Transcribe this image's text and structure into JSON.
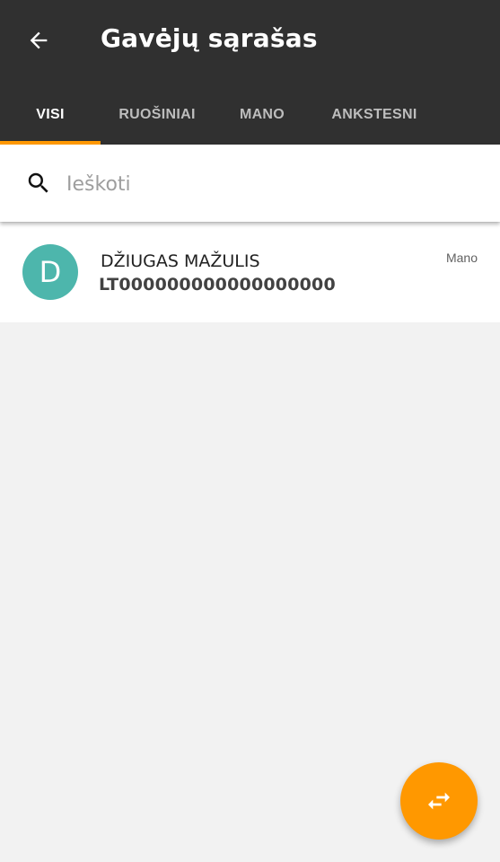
{
  "appbar": {
    "title": "Gavėjų sąrašas",
    "back_icon": "arrow-left-icon",
    "background_color": "#303030"
  },
  "tabs": [
    {
      "label": "VISI",
      "active": true
    },
    {
      "label": "RUOŠINIAI",
      "active": false
    },
    {
      "label": "MANO",
      "active": false
    },
    {
      "label": "ANKSTESNI",
      "active": false
    }
  ],
  "accent_color": "#ff9800",
  "search": {
    "placeholder": "Ieškoti",
    "value": "",
    "icon": "search-icon"
  },
  "recipients": [
    {
      "avatar_letter": "D",
      "avatar_color": "#4db6ac",
      "name": "DŽIUGAS MAŽULIS",
      "account": "LT000000000000000000",
      "badge": "Mano"
    }
  ],
  "fab": {
    "icon": "swap-arrows-icon",
    "color": "#ff9800"
  }
}
